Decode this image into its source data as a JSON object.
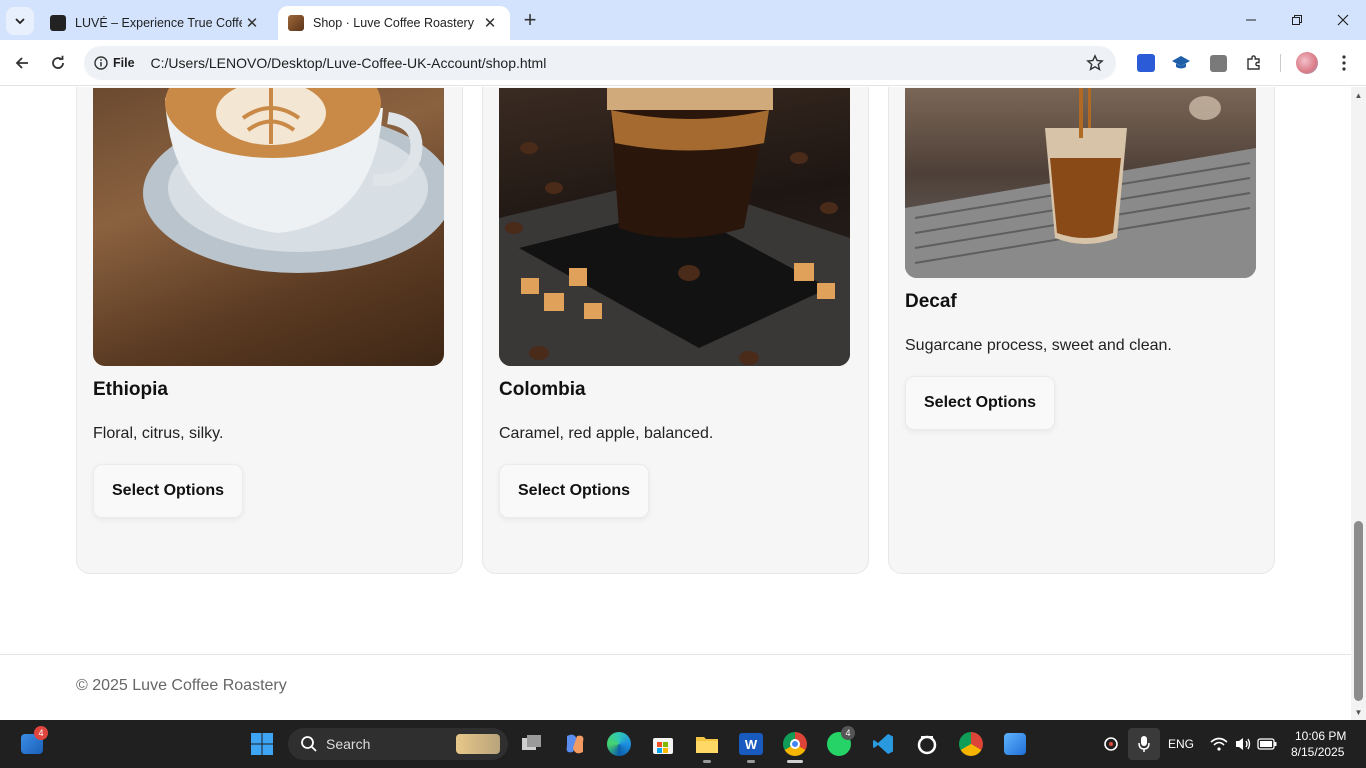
{
  "browser": {
    "tabs": [
      {
        "title": "LUVÉ – Experience True Coffee Bliss",
        "active": false
      },
      {
        "title": "Shop · Luve Coffee Roastery",
        "active": true
      }
    ],
    "omnibox": {
      "scheme_label": "File",
      "url": "C:/Users/LENOVO/Desktop/Luve-Coffee-UK-Account/shop.html"
    }
  },
  "products": [
    {
      "name": "Ethiopia",
      "description": "Floral, citrus, silky.",
      "button_label": "Select Options",
      "image": "latte-art-cup"
    },
    {
      "name": "Colombia",
      "description": "Caramel, red apple, balanced.",
      "button_label": "Select Options",
      "image": "layered-coffee-glass"
    },
    {
      "name": "Decaf",
      "description": "Sugarcane process, sweet and clean.",
      "button_label": "Select Options",
      "image": "iced-coffee-espresso"
    }
  ],
  "footer": {
    "copyright": "© 2025 Luve Coffee Roastery"
  },
  "taskbar": {
    "search_placeholder": "Search",
    "widgets_badge": "4",
    "whatsapp_badge": "4",
    "language": "ENG",
    "time": "10:06 PM",
    "date": "8/15/2025"
  },
  "colors": {
    "tabstrip": "#d3e3fd",
    "card_bg": "#f6f6f6",
    "taskbar": "#202020"
  }
}
